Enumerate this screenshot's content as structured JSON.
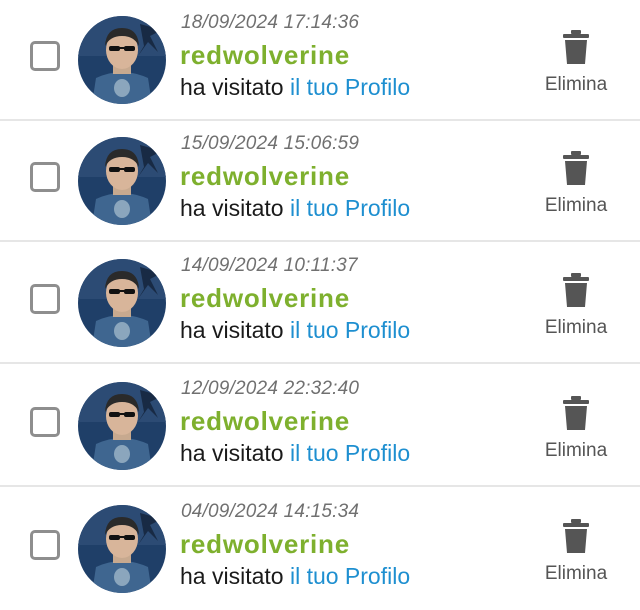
{
  "notifications": [
    {
      "date": "18/09/2024 17:14:36",
      "username": "redwolverine",
      "action_prefix": "ha visitato",
      "action_link": "il tuo Profilo",
      "delete_label": "Elimina"
    },
    {
      "date": "15/09/2024 15:06:59",
      "username": "redwolverine",
      "action_prefix": "ha visitato",
      "action_link": "il tuo Profilo",
      "delete_label": "Elimina"
    },
    {
      "date": "14/09/2024 10:11:37",
      "username": "redwolverine",
      "action_prefix": "ha visitato",
      "action_link": "il tuo Profilo",
      "delete_label": "Elimina"
    },
    {
      "date": "12/09/2024 22:32:40",
      "username": "redwolverine",
      "action_prefix": "ha visitato",
      "action_link": "il tuo Profilo",
      "delete_label": "Elimina"
    },
    {
      "date": "04/09/2024 14:15:34",
      "username": "redwolverine",
      "action_prefix": "ha visitato",
      "action_link": "il tuo Profilo",
      "delete_label": "Elimina"
    }
  ],
  "colors": {
    "username": "#7eb02e",
    "link": "#1e8fd0",
    "date": "#707070",
    "icon": "#555555"
  },
  "icons": {
    "delete": "trash-icon",
    "checkbox": "checkbox-icon"
  }
}
